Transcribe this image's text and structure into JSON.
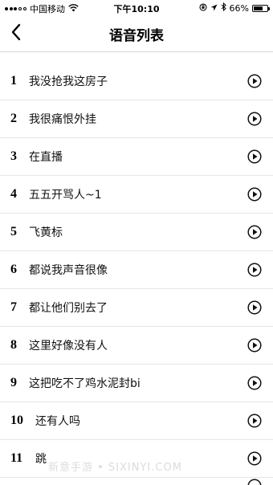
{
  "status_bar": {
    "carrier": "中国移动",
    "time": "下午10:10",
    "battery": "66%",
    "battery_level": 0.66
  },
  "nav": {
    "title": "语音列表",
    "back_icon": "chevron-left-icon"
  },
  "list": [
    {
      "number": "1",
      "label": "我没抢我这房子"
    },
    {
      "number": "2",
      "label": "我很痛恨外挂"
    },
    {
      "number": "3",
      "label": "在直播"
    },
    {
      "number": "4",
      "label": "五五开骂人~1"
    },
    {
      "number": "5",
      "label": "飞黄标"
    },
    {
      "number": "6",
      "label": "都说我声音很像"
    },
    {
      "number": "7",
      "label": "都让他们别去了"
    },
    {
      "number": "8",
      "label": "这里好像没有人"
    },
    {
      "number": "9",
      "label": "这把吃不了鸡水泥封bi"
    },
    {
      "number": "10",
      "label": "还有人吗"
    },
    {
      "number": "11",
      "label": "跳"
    }
  ],
  "watermark": "新意手游 • SIXINYI.COM",
  "icons": {
    "play": "play-circle-icon"
  },
  "colors": {
    "divider": "#e6e6e6",
    "text": "#111111"
  }
}
